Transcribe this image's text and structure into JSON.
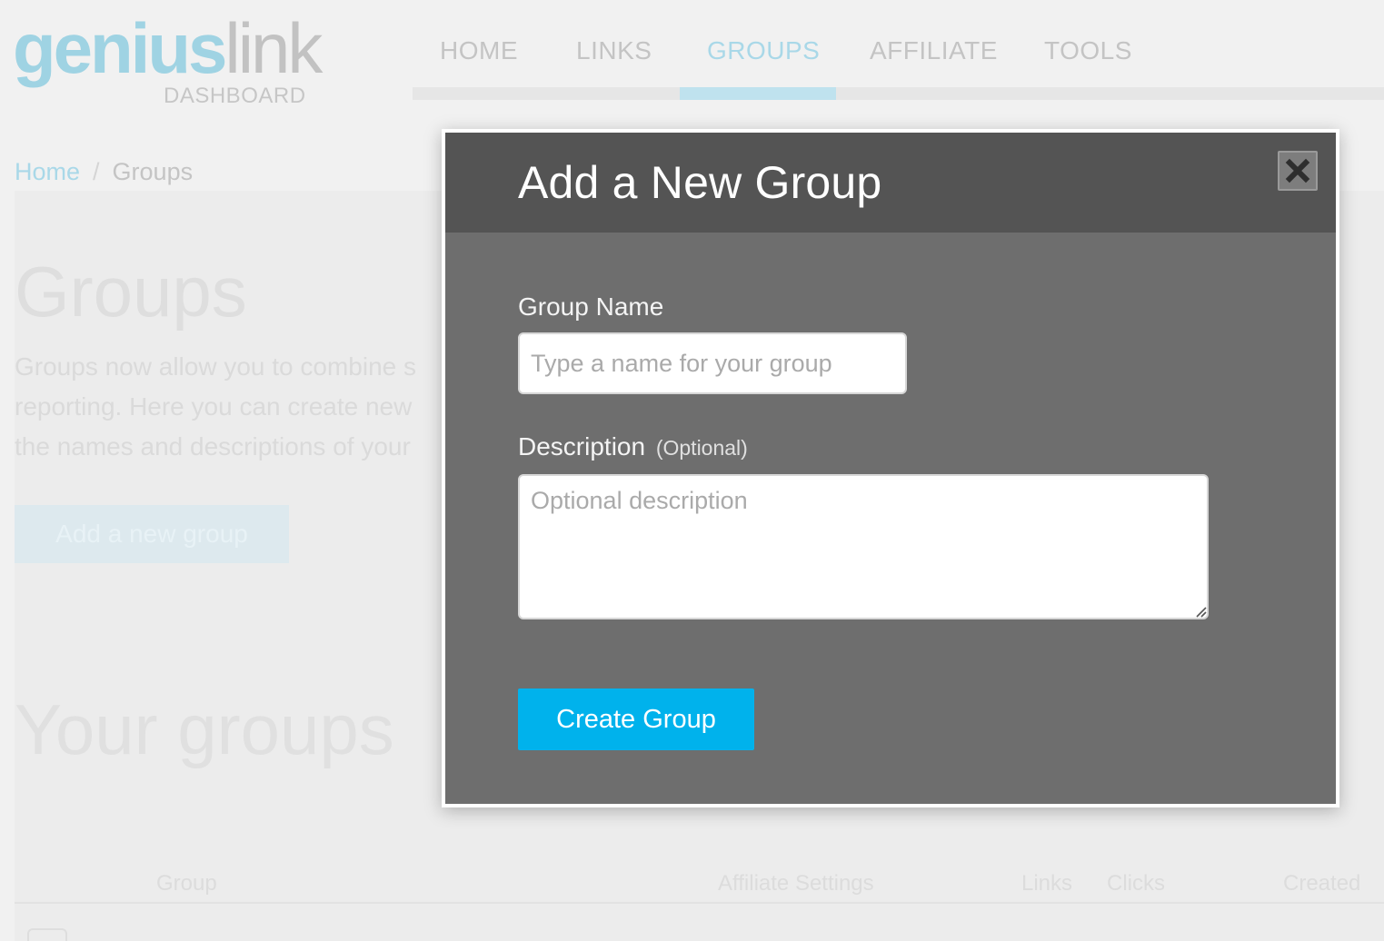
{
  "header": {
    "logo": {
      "word_part1": "genius",
      "word_part2": "link",
      "subtitle": "DASHBOARD"
    },
    "nav": [
      {
        "label": "HOME",
        "active": false
      },
      {
        "label": "LINKS",
        "active": false
      },
      {
        "label": "GROUPS",
        "active": true
      },
      {
        "label": "AFFILIATE",
        "active": false
      },
      {
        "label": "TOOLS",
        "active": false
      }
    ]
  },
  "breadcrumb": {
    "home": "Home",
    "separator": "/",
    "current": "Groups"
  },
  "main": {
    "title": "Groups",
    "intro_lines": [
      "Groups now allow you to combine s",
      "reporting. Here you can create new",
      "the names and descriptions of your"
    ],
    "add_button_label": "Add a new group",
    "your_groups_title": "Your groups",
    "table_headers": [
      "Group",
      "Affiliate Settings",
      "Links",
      "Clicks",
      "Created"
    ]
  },
  "modal": {
    "title": "Add a New Group",
    "close_icon": "close-icon",
    "group_name_label": "Group Name",
    "group_name_placeholder": "Type a name for your group",
    "group_name_value": "",
    "description_label": "Description",
    "description_optional": "(Optional)",
    "description_placeholder": "Optional description",
    "description_value": "",
    "create_button_label": "Create Group"
  },
  "colors": {
    "accent": "#00b2ec",
    "modal_header": "#545454",
    "modal_body": "#6e6e6e",
    "page_background": "#f1f1f1"
  }
}
